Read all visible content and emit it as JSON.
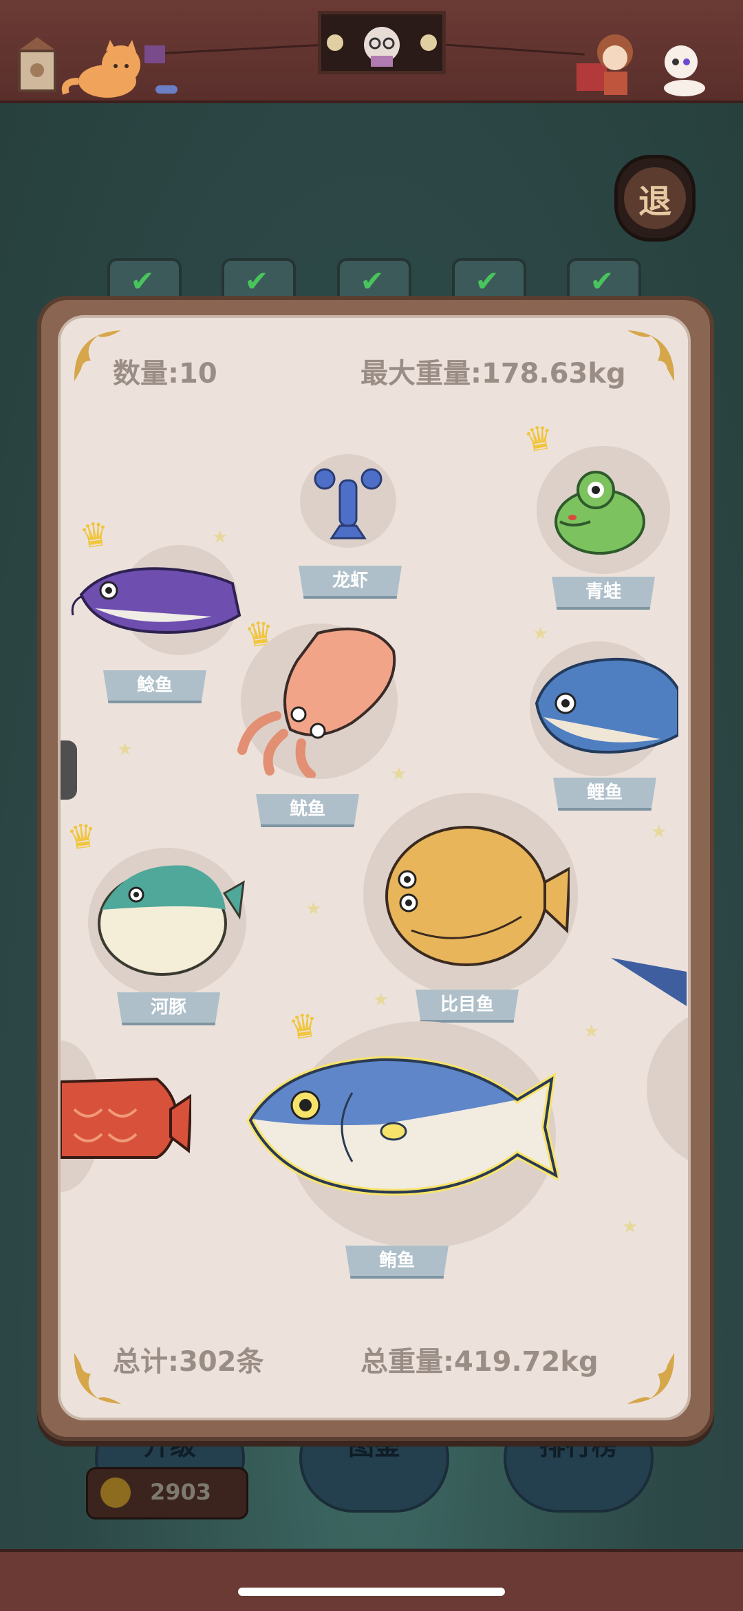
{
  "header": {
    "exit_label": "退"
  },
  "panel": {
    "count_label": "数量:10",
    "max_weight_label": "最大重量:178.63kg",
    "total_label": "总计:302条",
    "total_weight_label": "总重量:419.72kg"
  },
  "catches": [
    {
      "name": "龙虾",
      "crown": false
    },
    {
      "name": "青蛙",
      "crown": true
    },
    {
      "name": "鲶鱼",
      "crown": true
    },
    {
      "name": "鱿鱼",
      "crown": true
    },
    {
      "name": "鲤鱼",
      "crown": false
    },
    {
      "name": "河豚",
      "crown": true
    },
    {
      "name": "比目鱼",
      "crown": false
    },
    {
      "name": "鲔鱼",
      "crown": true
    }
  ],
  "bottom": {
    "buttons": [
      "升级",
      "图鉴",
      "排行榜"
    ],
    "coins": "2903"
  },
  "colors": {
    "panel_bg": "#ece2db",
    "label_bg": "#aebfc9",
    "crown": "#f1c53d"
  }
}
